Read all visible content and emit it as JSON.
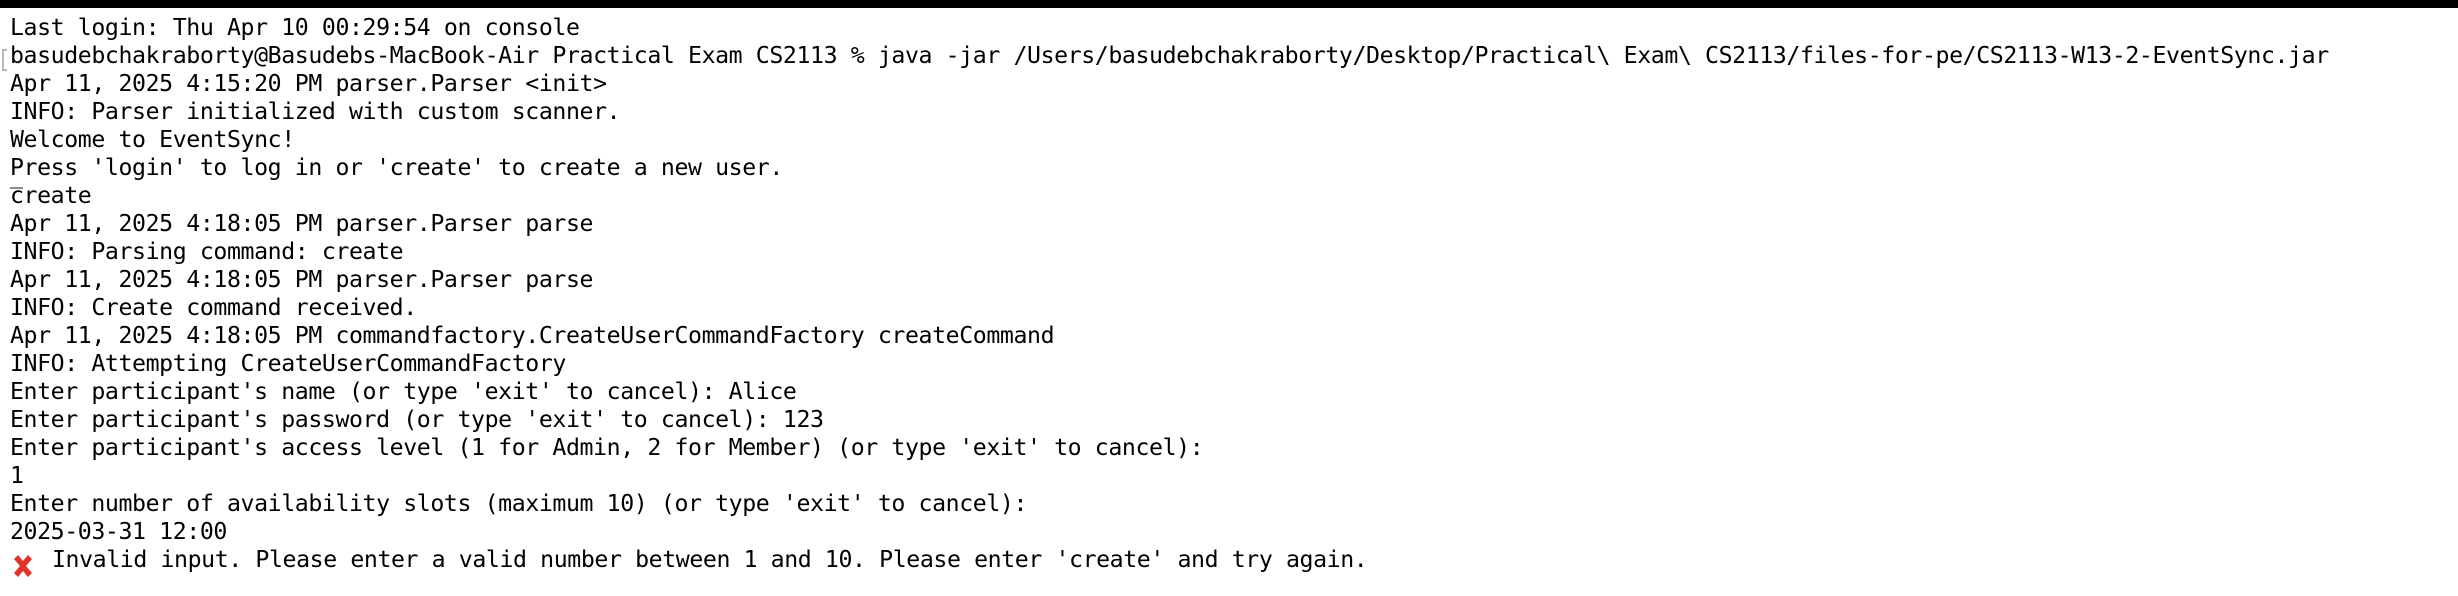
{
  "terminal": {
    "lines": [
      "Last login: Thu Apr 10 00:29:54 on console",
      "basudebchakraborty@Basudebs-MacBook-Air Practical Exam CS2113 % java -jar /Users/basudebchakraborty/Desktop/Practical\\ Exam\\ CS2113/files-for-pe/CS2113-W13-2-EventSync.jar",
      "Apr 11, 2025 4:15:20 PM parser.Parser <init>",
      "INFO: Parser initialized with custom scanner.",
      "Welcome to EventSync!",
      "Press 'login' to log in or 'create' to create a new user.",
      "create",
      "Apr 11, 2025 4:18:05 PM parser.Parser parse",
      "INFO: Parsing command: create",
      "Apr 11, 2025 4:18:05 PM parser.Parser parse",
      "INFO: Create command received.",
      "Apr 11, 2025 4:18:05 PM commandfactory.CreateUserCommandFactory createCommand",
      "INFO: Attempting CreateUserCommandFactory",
      "Enter participant's name (or type 'exit' to cancel): Alice",
      "Enter participant's password (or type 'exit' to cancel): 123",
      "Enter participant's access level (1 for Admin, 2 for Member) (or type 'exit' to cancel):",
      "1",
      "Enter number of availability slots (maximum 10) (or type 'exit' to cancel):",
      "2025-03-31 12:00"
    ],
    "error_line": "Invalid input. Please enter a valid number between 1 and 10. Please enter 'create' and try again.",
    "error_icon": "cross-mark-icon",
    "colors": {
      "background": "#ffffff",
      "text": "#000000",
      "error_icon": "#e0312b",
      "top_bar": "#000000"
    }
  }
}
